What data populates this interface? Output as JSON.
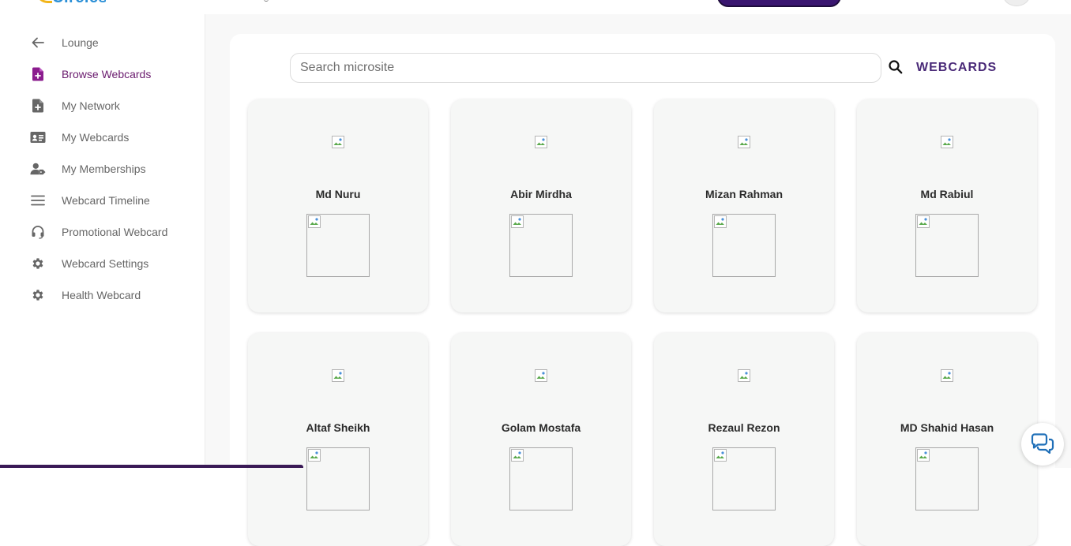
{
  "brand": {
    "logo_text": "Circles"
  },
  "sidebar": {
    "items": [
      {
        "label": "Lounge",
        "icon": "arrow-left-icon",
        "active": false
      },
      {
        "label": "Browse Webcards",
        "icon": "file-plus-icon",
        "active": true
      },
      {
        "label": "My Network",
        "icon": "file-plus-icon",
        "active": false
      },
      {
        "label": "My Webcards",
        "icon": "id-card-icon",
        "active": false
      },
      {
        "label": "My Memberships",
        "icon": "user-tag-icon",
        "active": false
      },
      {
        "label": "Webcard Timeline",
        "icon": "menu-lines-icon",
        "active": false
      },
      {
        "label": "Promotional Webcard",
        "icon": "headset-icon",
        "active": false
      },
      {
        "label": "Webcard Settings",
        "icon": "gear-icon",
        "active": false
      },
      {
        "label": "Health Webcard",
        "icon": "gear-icon",
        "active": false
      }
    ]
  },
  "search": {
    "placeholder": "Search microsite",
    "value": ""
  },
  "header": {
    "webcards_label": "WEBCARDS"
  },
  "cards": [
    {
      "name": "Md Nuru"
    },
    {
      "name": "Abir Mirdha"
    },
    {
      "name": "Mizan Rahman"
    },
    {
      "name": "Md Rabiul"
    },
    {
      "name": "Altaf Sheikh"
    },
    {
      "name": "Golam Mostafa"
    },
    {
      "name": "Rezaul Rezon"
    },
    {
      "name": "MD Shahid Hasan"
    }
  ],
  "colors": {
    "accent": "#4a2a78",
    "active_nav": "#6a1b6e",
    "chat_icon": "#1f6fb8"
  }
}
